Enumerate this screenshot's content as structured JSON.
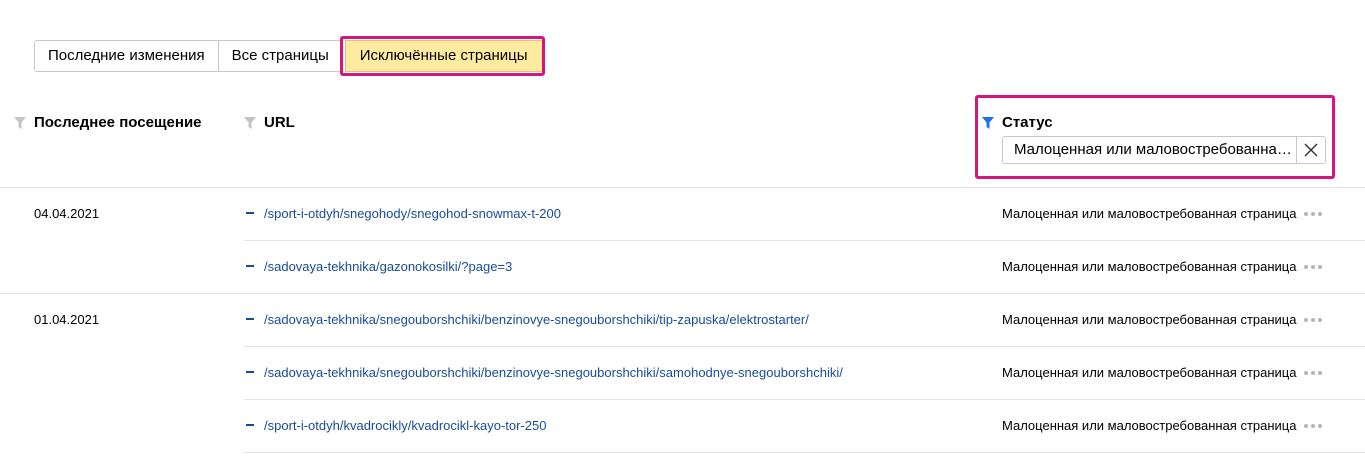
{
  "tabs": [
    {
      "label": "Последние изменения"
    },
    {
      "label": "Все страницы"
    },
    {
      "label": "Исключённые страницы"
    }
  ],
  "columns": {
    "last_visit": "Последнее посещение",
    "url": "URL",
    "status": "Статус"
  },
  "status_filter": {
    "value": "Малоценная или маловостребованная страница"
  },
  "groups": [
    {
      "date": "04.04.2021",
      "rows": [
        {
          "url": "/sport-i-otdyh/snegohody/snegohod-snowmax-t-200",
          "status": "Малоценная или маловостребованная страница"
        },
        {
          "url": "/sadovaya-tekhnika/gazonokosilki/?page=3",
          "status": "Малоценная или маловостребованная страница"
        }
      ]
    },
    {
      "date": "01.04.2021",
      "rows": [
        {
          "url": "/sadovaya-tekhnika/snegouborshchiki/benzinovye-snegouborshchiki/tip-zapuska/elektrostarter/",
          "status": "Малоценная или маловостребованная страница"
        },
        {
          "url": "/sadovaya-tekhnika/snegouborshchiki/benzinovye-snegouborshchiki/samohodnye-snegouborshchiki/",
          "status": "Малоценная или маловостребованная страница"
        },
        {
          "url": "/sport-i-otdyh/kvadrocikly/kvadrocikl-kayo-tor-250",
          "status": "Малоценная или маловостребованная страница"
        }
      ]
    }
  ],
  "colors": {
    "highlight": "#d6157f",
    "active_tab_bg": "#ffeba0",
    "link": "#1a4b9b",
    "active_filter_icon": "#1a73e8"
  }
}
